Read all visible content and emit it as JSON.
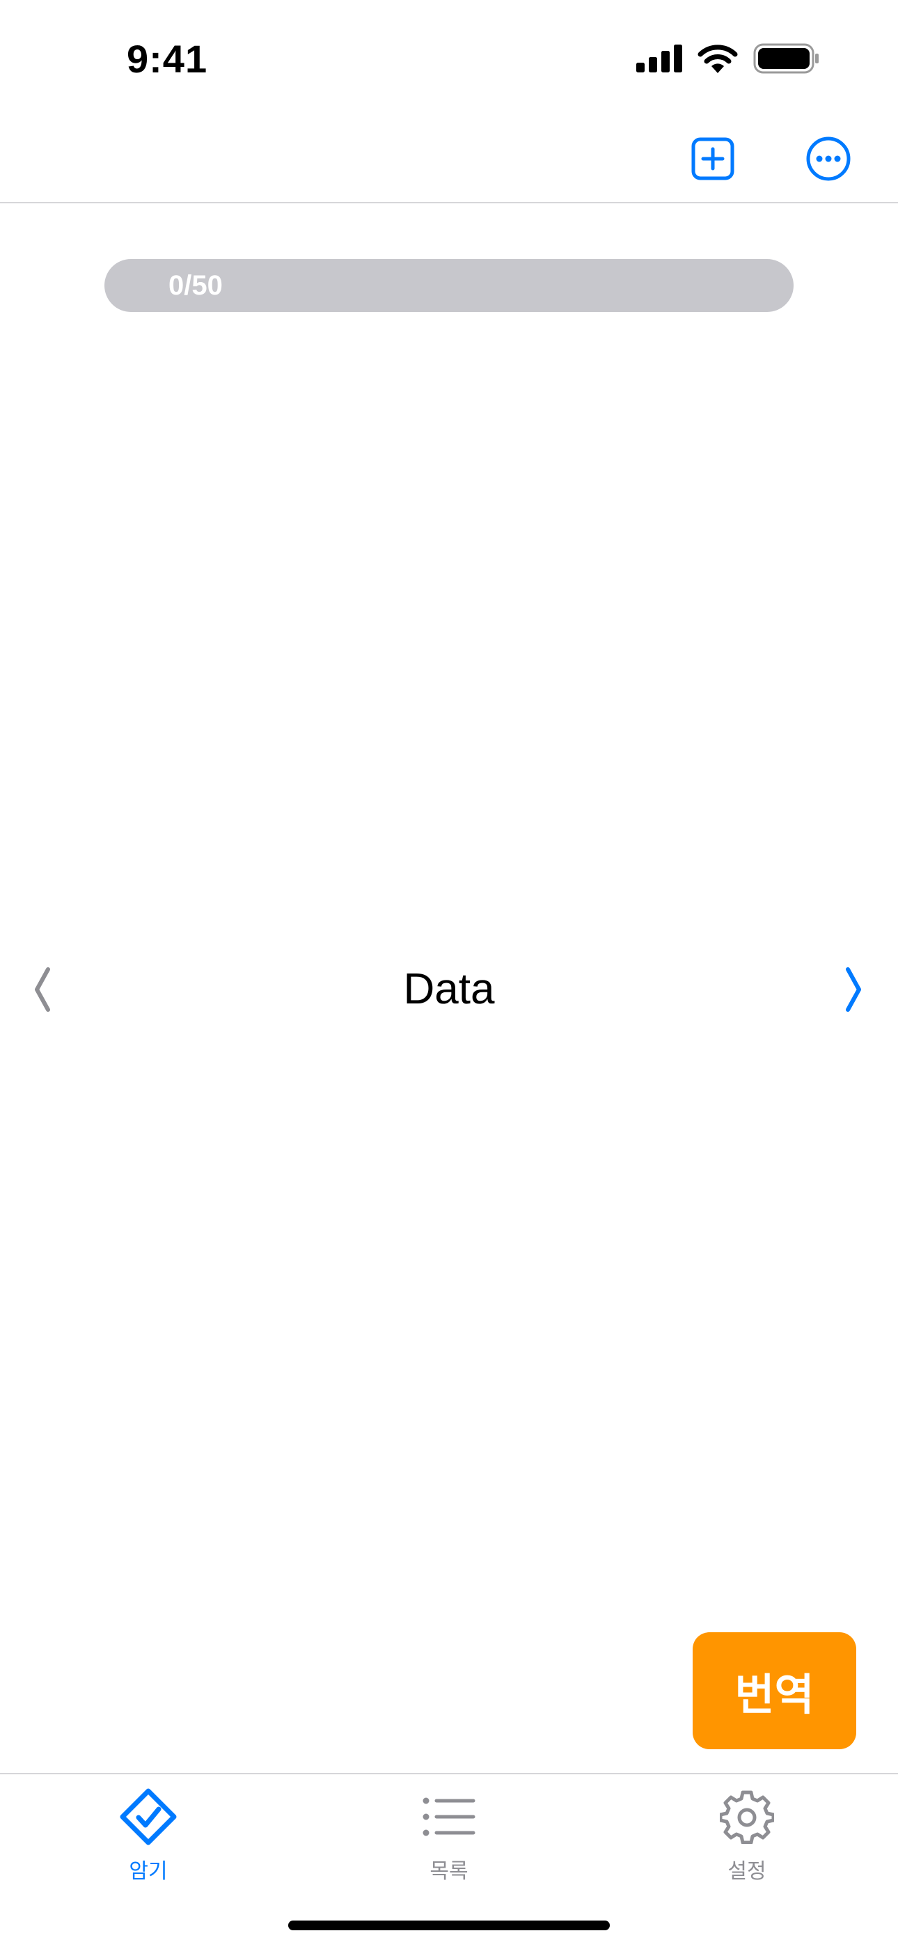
{
  "status_bar": {
    "time": "9:41"
  },
  "nav": {
    "add_icon": "plus-square-icon",
    "more_icon": "ellipsis-circle-icon"
  },
  "progress": {
    "label": "0/50",
    "current": 0,
    "total": 50,
    "fraction": 0
  },
  "card": {
    "word": "Data",
    "prev_icon": "chevron-left-icon",
    "next_icon": "chevron-right-icon"
  },
  "translate_button": {
    "label": "번역"
  },
  "tabs": [
    {
      "label": "암기",
      "icon": "checkmark-diamond-icon",
      "active": true
    },
    {
      "label": "목록",
      "icon": "list-bullet-icon",
      "active": false
    },
    {
      "label": "설정",
      "icon": "gear-icon",
      "active": false
    }
  ],
  "colors": {
    "accent": "#007aff",
    "translate": "#ff9500",
    "progress_track": "#c7c7cc",
    "inactive": "#8e8e93"
  }
}
